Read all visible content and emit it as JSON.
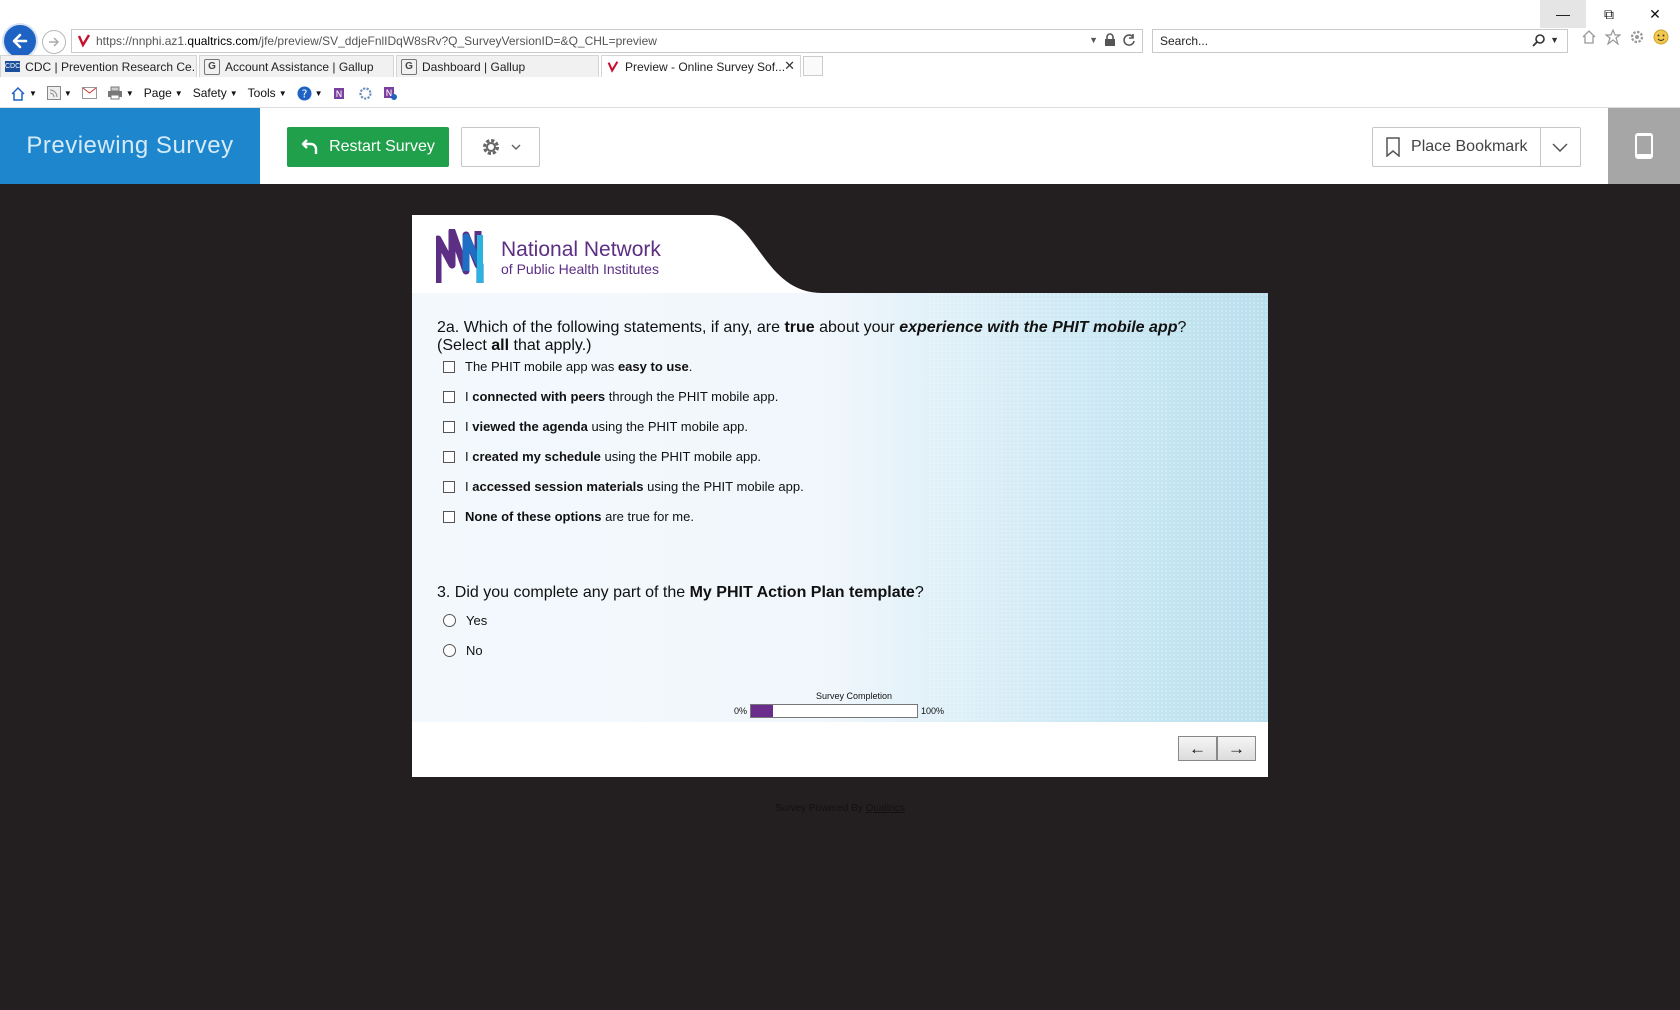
{
  "browser": {
    "url_prefix": "https://nnphi.az1.",
    "url_domain": "qualtrics.com",
    "url_suffix": "/jfe/preview/SV_ddjeFnlIDqW8sRv?Q_SurveyVersionID=&Q_CHL=preview",
    "search_placeholder": "Search...",
    "tabs": [
      {
        "label": "CDC | Prevention Research Ce...",
        "favicon": "CDC",
        "active": false
      },
      {
        "label": "Account Assistance | Gallup",
        "favicon": "G",
        "active": false
      },
      {
        "label": "Dashboard | Gallup",
        "favicon": "G",
        "active": false
      },
      {
        "label": "Preview - Online Survey Sof...",
        "favicon": "Q",
        "active": true
      }
    ],
    "command_bar": {
      "page_label": "Page",
      "safety_label": "Safety",
      "tools_label": "Tools"
    }
  },
  "preview_header": {
    "title": "Previewing Survey",
    "restart_label": "Restart Survey",
    "bookmark_label": "Place Bookmark"
  },
  "logo": {
    "line1": "National Network",
    "line2": "of Public Health Institutes"
  },
  "questions": {
    "q2a": {
      "number": "2a.",
      "t1": "Which of the following statements, if any, are ",
      "t2": "true",
      "t3": " about your ",
      "t4": "experience with the PHIT mobile app",
      "t5": "?",
      "t6": "(Select ",
      "t7": "all",
      "t8": " that apply.)",
      "options": [
        {
          "pre": "The PHIT mobile app was ",
          "bold": "easy to use",
          "post": "."
        },
        {
          "pre": "I ",
          "bold": "connected with peers",
          "post": " through the PHIT mobile app."
        },
        {
          "pre": "I ",
          "bold": "viewed the agenda",
          "post": " using the PHIT mobile app."
        },
        {
          "pre": "I ",
          "bold": "created my schedule",
          "post": " using the PHIT mobile app."
        },
        {
          "pre": "I ",
          "bold": "accessed session materials",
          "post": " using the PHIT mobile app."
        },
        {
          "pre": "",
          "bold": "None of these options",
          "post": " are true for me."
        }
      ]
    },
    "q3": {
      "number": "3.",
      "t1": "Did you complete any part of the ",
      "t2": "My PHIT Action Plan template",
      "t3": "?",
      "options": [
        "Yes",
        "No"
      ]
    }
  },
  "progress": {
    "label": "Survey Completion",
    "min_label": "0%",
    "max_label": "100%",
    "value": 0.13
  },
  "nav": {
    "back_glyph": "←",
    "next_glyph": "→"
  },
  "footer": {
    "powered_prefix": "Survey Powered By ",
    "powered_link": "Qualtrics"
  },
  "colors": {
    "preview_blue": "#1e86cc",
    "restart_green": "#20a04a",
    "progress_purple": "#6a2d8c",
    "page_background": "#231f20"
  }
}
